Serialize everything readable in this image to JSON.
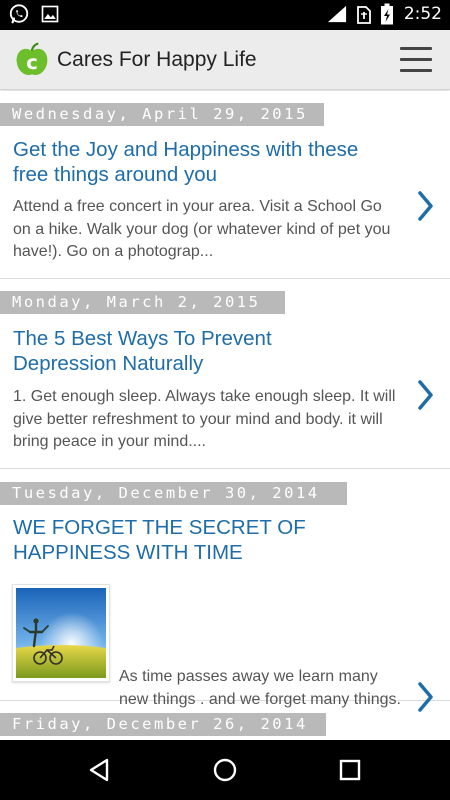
{
  "status_bar": {
    "time": "2:52",
    "left_icons": [
      "whatsapp-icon",
      "image-icon"
    ],
    "right_icons": [
      "signal-icon",
      "sim-icon",
      "battery-charging-icon"
    ]
  },
  "app_bar": {
    "logo_icon": "apple-c-logo-icon",
    "title": "Cares For Happy Life",
    "menu_icon": "hamburger-menu-icon"
  },
  "colors": {
    "title_link": "#1e6da8",
    "chevron": "#1e6da8",
    "date_chip_bg": "#b9b9b9",
    "excerpt_text": "#555555",
    "logo_green": "#6cbf2a"
  },
  "posts": [
    {
      "date": "Wednesday, April 29, 2015",
      "title": "Get the Joy and Happiness with these free things around you",
      "excerpt": "Attend a free concert in your area. Visit a School Go on a hike. Walk your dog (or whatever kind of pet you have!). Go on a photograp...",
      "has_thumbnail": false
    },
    {
      "date": "Monday, March 2, 2015",
      "title": "The 5 Best Ways To Prevent Depression Naturally",
      "excerpt": "1. Get enough sleep.  Always take enough sleep. It will give better refreshment to your mind and body. it will bring peace in your mind....",
      "has_thumbnail": false
    },
    {
      "date": "Tuesday, December 30, 2014",
      "title": "WE FORGET THE SECRET OF HAPPINESS WITH TIME",
      "excerpt": "As time passes away we learn many new things . and we forget many things. and we move on in lif...",
      "has_thumbnail": true,
      "thumbnail_icon": "person-with-bicycle-in-field-image"
    },
    {
      "date": "Friday, December 26, 2014"
    }
  ],
  "nav_bar": {
    "icons": [
      "back-triangle-icon",
      "home-circle-icon",
      "recents-square-icon"
    ]
  }
}
